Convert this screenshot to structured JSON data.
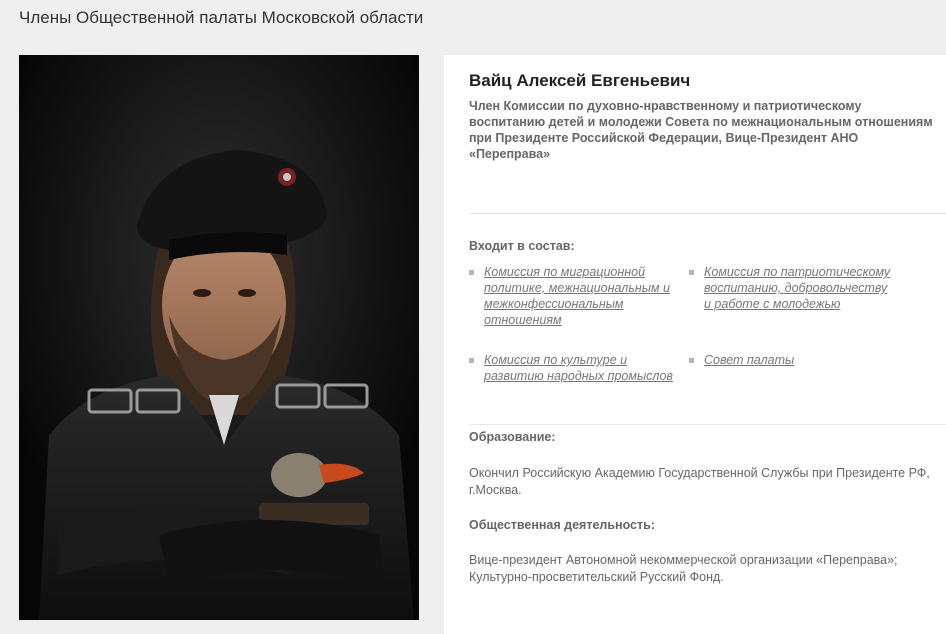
{
  "page": {
    "title": "Члены Общественной палаты Московской области"
  },
  "member": {
    "name": "Вайц Алексей Евгеньевич",
    "position": "Член Комиссии по духовно-нравственному и патриотическому воспитанию детей и молодежи Совета по межнациональным отношениям при Президенте Российской Федерации, Вице-Президент АНО «Переправа»",
    "memberships_label": "Входит в состав:",
    "memberships": [
      "Комиссия по миграционной политике, межнациональным и межконфессиональным отношениям",
      "Комиссия по патриотическому воспитанию, добровольчеству и работе с молодежью",
      "Комиссия по культуре и развитию народных промыслов",
      "Совет палаты"
    ],
    "education_label": "Образование:",
    "education": "Окончил Российскую Академию Государственной Службы при Президенте РФ, г.Москва.",
    "activity_label": "Общественная деятельность:",
    "activity": "Вице-президент Автономной некоммерческой организации «Переправа»; Культурно-просветительский Русский Фонд."
  },
  "colors": {
    "page_bg": "#efefef",
    "card_bg": "#ffffff",
    "link": "#777777",
    "bullet": "#b5b5b5"
  }
}
